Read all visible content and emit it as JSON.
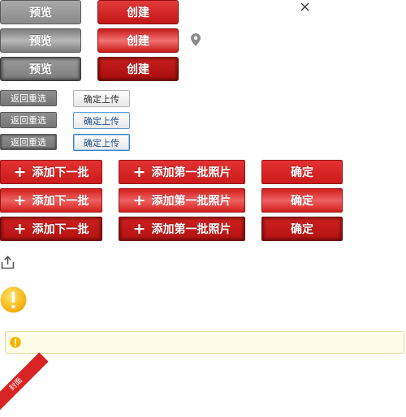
{
  "buttons": {
    "preview": "预览",
    "create": "创建",
    "return_reselect": "返回重选",
    "confirm_upload": "确定上传",
    "add_next_batch": "添加下一批",
    "add_first_batch_photos": "添加第一批照片",
    "confirm": "确定"
  },
  "ribbon": {
    "label": "封面"
  },
  "icons": {
    "close": "close-icon",
    "location": "map-pin-icon",
    "share": "share-icon",
    "warning_large": "warning-icon",
    "warning_small": "warning-icon",
    "plus": "plus-icon"
  },
  "colors": {
    "red": "#d92323",
    "gray": "#8a8a8a",
    "warning": "#f5b400",
    "tip_bg": "#fffde8",
    "blue_border": "#3b82c6"
  }
}
